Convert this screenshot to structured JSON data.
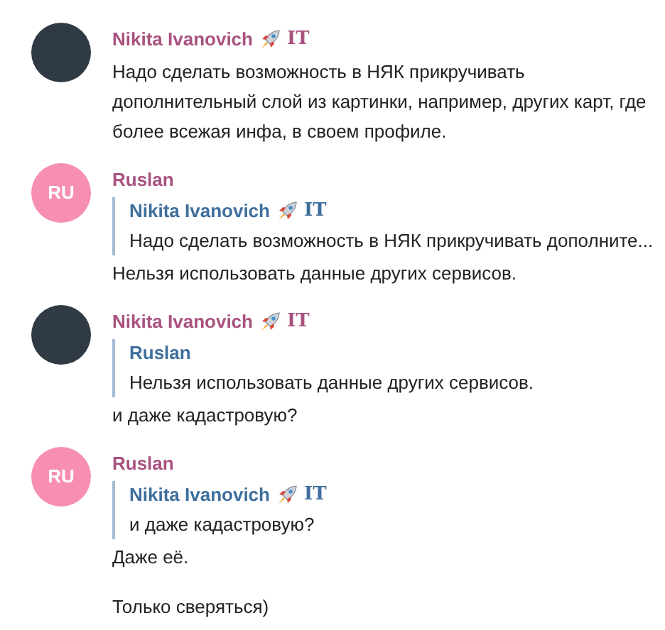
{
  "messages": [
    {
      "avatar": {
        "kind": "photo"
      },
      "sender": "Nikita Ivanovich",
      "sender_badge": "IT",
      "items": [
        {
          "text": "Надо сделать возможность в НЯК прикручивать дополнительный слой из картинки, например, других карт, где более всежая инфа, в своем профиле."
        }
      ]
    },
    {
      "avatar": {
        "kind": "initials",
        "initials": "RU",
        "color": "#f78fb3"
      },
      "sender": "Ruslan",
      "items": [
        {
          "reply": {
            "sender": "Nikita Ivanovich",
            "sender_badge": "IT",
            "text": "Надо сделать возможность в НЯК прикручивать дополните..."
          },
          "text": "Нельзя использовать данные других сервисов."
        }
      ]
    },
    {
      "avatar": {
        "kind": "photo"
      },
      "sender": "Nikita Ivanovich",
      "sender_badge": "IT",
      "items": [
        {
          "reply": {
            "sender": "Ruslan",
            "text": "Нельзя использовать данные других сервисов."
          },
          "text": "и даже кадастровую?"
        }
      ]
    },
    {
      "avatar": {
        "kind": "initials",
        "initials": "RU",
        "color": "#f78fb3"
      },
      "sender": "Ruslan",
      "items": [
        {
          "reply": {
            "sender": "Nikita Ivanovich",
            "sender_badge": "IT",
            "text": "и даже кадастровую?"
          },
          "text": "Даже её."
        },
        {
          "text": "Только сверяться)"
        }
      ]
    }
  ]
}
